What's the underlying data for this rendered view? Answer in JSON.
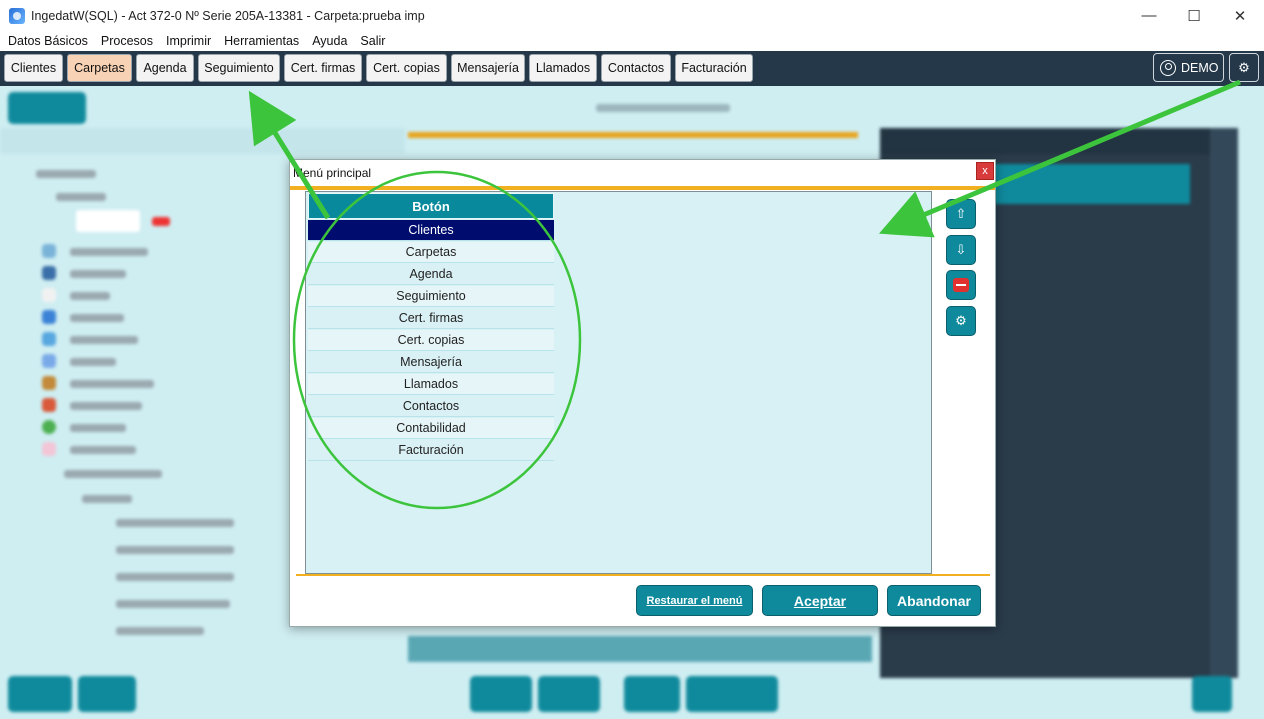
{
  "window": {
    "title": "IngedatW(SQL) - Act 372-0 Nº Serie 205A-13381 - Carpeta:prueba imp",
    "minimize": "—",
    "maximize": "☐",
    "close": "✕"
  },
  "menubar": [
    "Datos Básicos",
    "Procesos",
    "Imprimir",
    "Herramientas",
    "Ayuda",
    "Salir"
  ],
  "toolbar": {
    "buttons": [
      "Clientes",
      "Carpetas",
      "Agenda",
      "Seguimiento",
      "Cert. firmas",
      "Cert. copias",
      "Mensajería",
      "Llamados",
      "Contactos",
      "Facturación"
    ],
    "active": "Carpetas",
    "user_label": "DEMO",
    "settings_glyph": "⚙"
  },
  "dialog": {
    "title": "Menú principal",
    "close_glyph": "x",
    "column_header": "Botón",
    "rows": [
      "Clientes",
      "Carpetas",
      "Agenda",
      "Seguimiento",
      "Cert. firmas",
      "Cert. copias",
      "Mensajería",
      "Llamados",
      "Contactos",
      "Contabilidad",
      "Facturación"
    ],
    "selected_row": "Clientes",
    "side_buttons": {
      "up": "⇧",
      "down": "⇩",
      "settings": "⚙"
    },
    "restore_label": "Restaurar el menú",
    "accept_label": "Aceptar",
    "cancel_label": "Abandonar"
  },
  "colors": {
    "toolbar_bg": "#24384a",
    "teal": "#0f8a9c",
    "selected_row": "#000d6e",
    "accent_orange": "#f2b021",
    "annotation_green": "#3cc43c"
  }
}
